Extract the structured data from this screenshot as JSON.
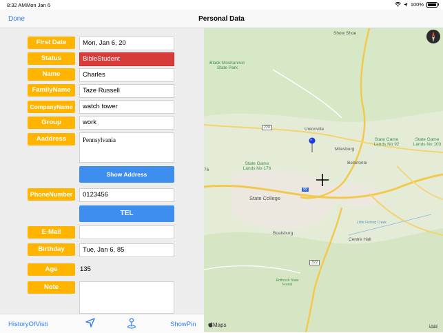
{
  "status_bar": {
    "time": "8:32 AM",
    "date": "Mon Jan 6",
    "battery": "100%",
    "battery_level": 1.0
  },
  "nav": {
    "done": "Done",
    "title": "Personal Data"
  },
  "form": {
    "first_date": {
      "label": "First Date",
      "value": "Mon, Jan 6, 20"
    },
    "status": {
      "label": "Status",
      "value": "BibleStudent"
    },
    "name": {
      "label": "Name",
      "value": "Charles"
    },
    "family_name": {
      "label": "FamilyName",
      "value": "Taze Russell"
    },
    "company_name": {
      "label": "CompanyName",
      "value": "watch tower"
    },
    "group": {
      "label": "Group",
      "value": "work"
    },
    "address": {
      "label": "Aaddress",
      "value": "Pennsylvania"
    },
    "show_address": "Show Address",
    "phone": {
      "label": "PhoneNumber",
      "value": "0123456"
    },
    "tel": "TEL",
    "email": {
      "label": "E-Mail",
      "value": ""
    },
    "birthday": {
      "label": "Birthday",
      "value": "Tue, Jan 6, 85"
    },
    "age": {
      "label": "Age",
      "value": "135"
    },
    "note": {
      "label": "Note",
      "value": ""
    }
  },
  "toolbar": {
    "history": "HistoryOfVisti",
    "show_pin": "ShowPin",
    "icons": [
      "location-arrow-icon",
      "pin-icon"
    ]
  },
  "map": {
    "labels": {
      "show_shoe": "Show Shoe",
      "black_moshannon": "Black Moshannon State Park",
      "unionville": "Unionville",
      "milesburg": "Milesburg",
      "sgl92": "State Game Lands No 92",
      "sgl103": "State Game Lands No 103",
      "sgl176": "State Game Lands No 176",
      "bellefonte": "Bellefonte",
      "state_college": "State College",
      "boalsburg": "Boalsburg",
      "centre_hall": "Centre Hall",
      "little_fishing": "Little Fishing Creek",
      "rothrock": "Rothrock State Forest",
      "r220": "220",
      "r322": "322",
      "i99": "99",
      "edge76": "76"
    },
    "maps_logo": "Maps",
    "legal": "Legal",
    "pin_color": "#1a3bd6"
  },
  "colors": {
    "accent": "#2d7cf6",
    "label_bg": "#ffb400",
    "status_red": "#d93a3a",
    "button_blue": "#3e8ef0"
  }
}
